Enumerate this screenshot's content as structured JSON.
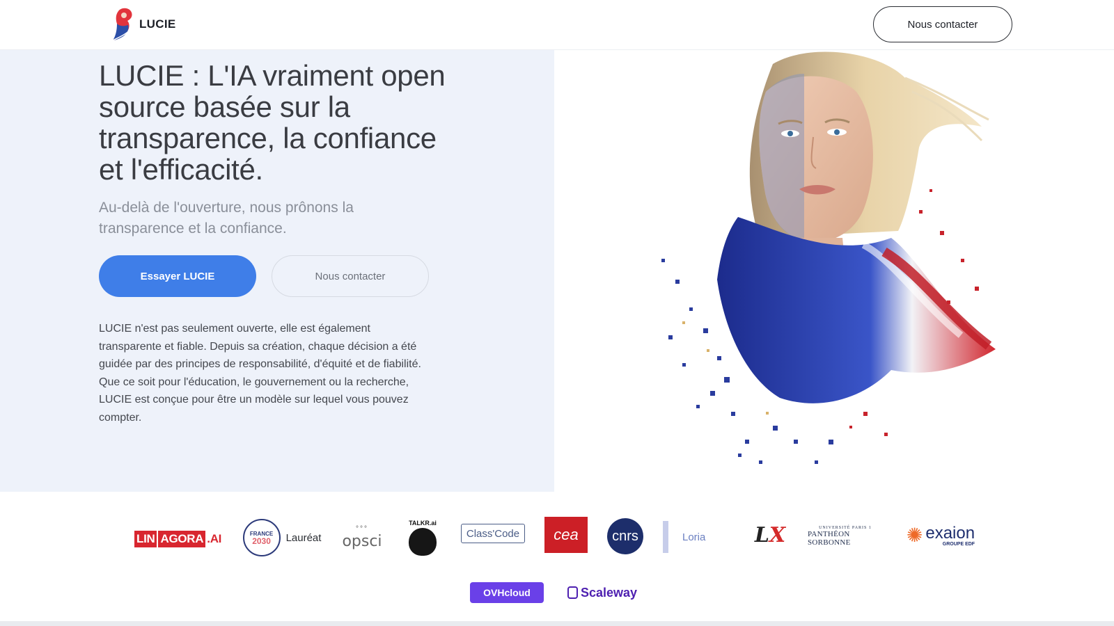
{
  "header": {
    "logo_text": "LUCIE",
    "contact_button": "Nous contacter"
  },
  "hero": {
    "title": "LUCIE : L'IA vraiment open source basée sur la transparence, la confiance et l'efficacité.",
    "subtitle": "Au-delà de l'ouverture, nous prônons la transparence et la confiance.",
    "primary_button": "Essayer LUCIE",
    "secondary_button": "Nous contacter",
    "body": "LUCIE n'est pas seulement ouverte, elle est également transparente et fiable. Depuis sa création, chaque décision a été guidée par des principes de responsabilité, d'équité et de fiabilité. Que ce soit pour l'éducation, le gouvernement ou la recherche, LUCIE est conçue pour être un modèle sur lequel vous pouvez compter."
  },
  "partners": {
    "linagora": {
      "lin": "LIN",
      "agora": "AGORA",
      "ai": ".AI"
    },
    "france2030": {
      "top": "FRANCE",
      "year": "2030",
      "label": "Lauréat"
    },
    "opsci": "opsci",
    "talkr": "TALKR.ai",
    "classcode": "Class'Code",
    "cea": "cea",
    "cnrs": "cnrs",
    "loria": "Loria",
    "lix": {
      "l": "L",
      "x": "X"
    },
    "pantheon": {
      "small": "UNIVERSITÉ PARIS 1",
      "main": "PANTHÉON SORBONNE"
    },
    "exaion": {
      "word": "exaion",
      "group": "GROUPE EDF"
    },
    "ovh": "OVHcloud",
    "scaleway": "Scaleway"
  },
  "colors": {
    "primary": "#3f7ee8",
    "hero_bg": "#eef2fa",
    "title": "#3a3c42"
  }
}
